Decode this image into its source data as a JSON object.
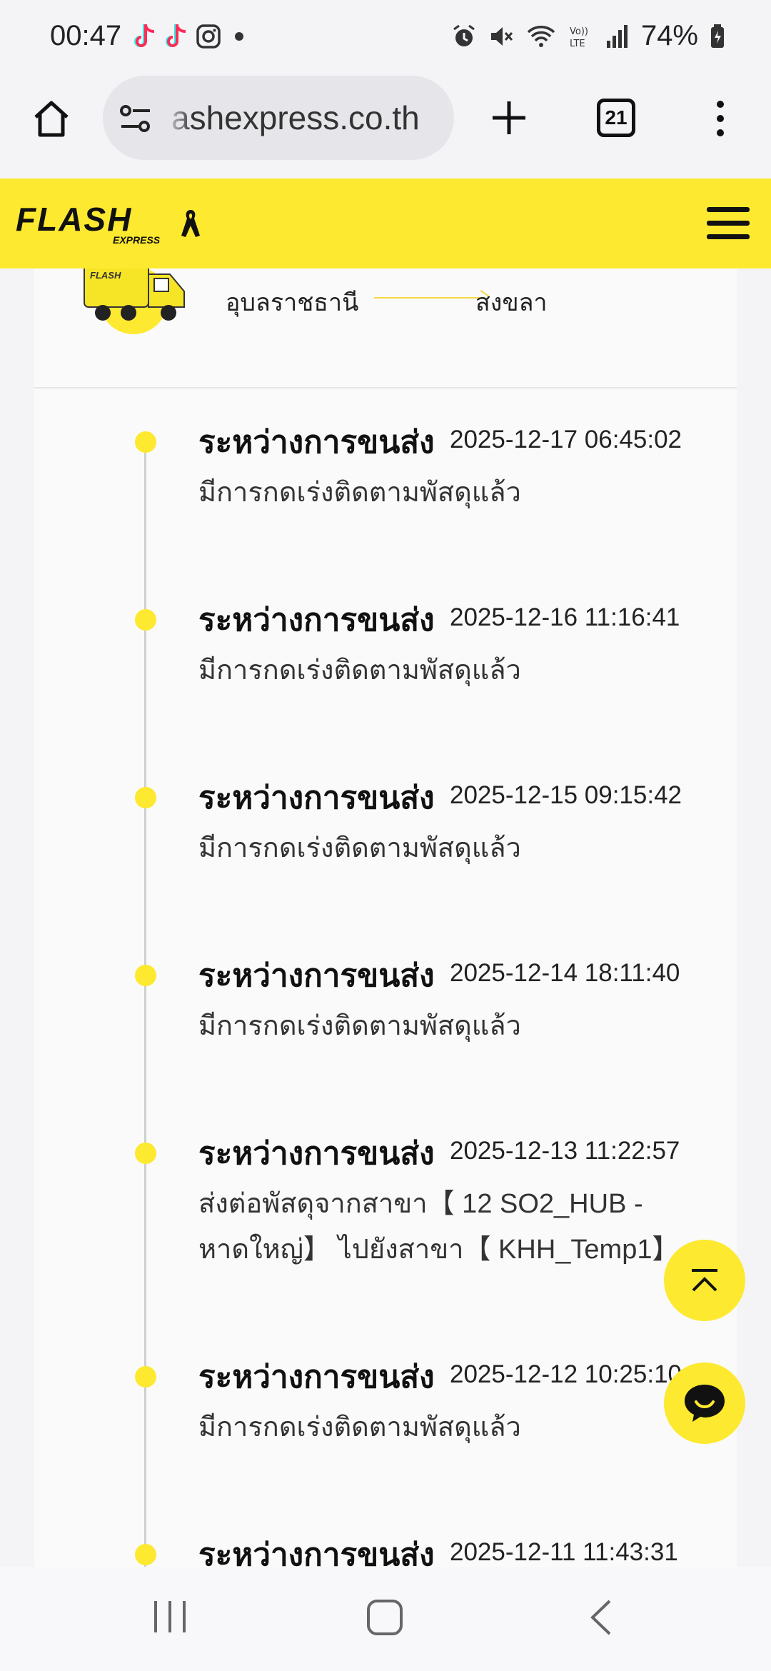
{
  "status_bar": {
    "time": "00:47",
    "battery": "74%"
  },
  "browser": {
    "url": "ashexpress.co.th",
    "tab_count": "21"
  },
  "site": {
    "logo_text": "FLASH",
    "logo_sub": "EXPRESS"
  },
  "route": {
    "from": "อุบลราชธานี",
    "to": "สงขลา"
  },
  "events": [
    {
      "title": "ระหว่างการขนส่ง",
      "time": "2025-12-17  06:45:02",
      "desc": "มีการกดเร่งติดตามพัสดุแล้ว"
    },
    {
      "title": "ระหว่างการขนส่ง",
      "time": "2025-12-16  11:16:41",
      "desc": "มีการกดเร่งติดตามพัสดุแล้ว"
    },
    {
      "title": "ระหว่างการขนส่ง",
      "time": "2025-12-15  09:15:42",
      "desc": "มีการกดเร่งติดตามพัสดุแล้ว"
    },
    {
      "title": "ระหว่างการขนส่ง",
      "time": "2025-12-14  18:11:40",
      "desc": "มีการกดเร่งติดตามพัสดุแล้ว"
    },
    {
      "title": "ระหว่างการขนส่ง",
      "time": "2025-12-13  11:22:57",
      "desc": "ส่งต่อพัสดุจากสาขา【 12 SO2_HUB - หาดใหญ่】 ไปยังสาขา【 KHH_Temp1】"
    },
    {
      "title": "ระหว่างการขนส่ง",
      "time": "2025-12-12  10:25:10",
      "desc": "มีการกดเร่งติดตามพัสดุแล้ว"
    },
    {
      "title": "ระหว่างการขนส่ง",
      "time": "2025-12-11  11:43:31",
      "desc": ""
    }
  ],
  "colors": {
    "brand_yellow": "#fde92f",
    "background": "#f4f4f7"
  }
}
